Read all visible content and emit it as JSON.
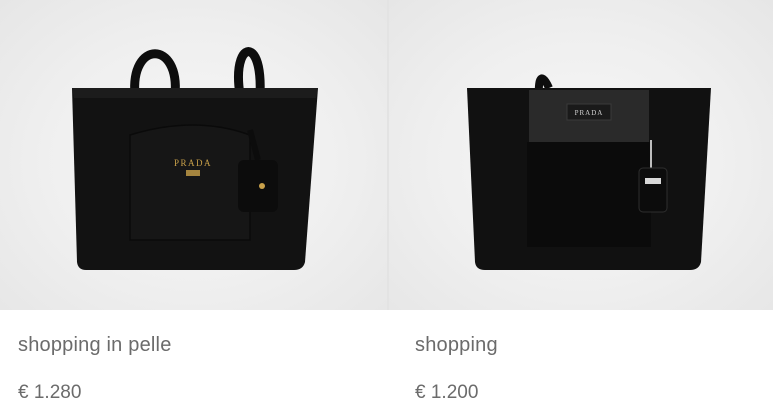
{
  "products": [
    {
      "name": "shopping in pelle",
      "price": "€ 1.280",
      "brand_mark": "PRADA"
    },
    {
      "name": "shopping",
      "price": "€ 1.200",
      "brand_mark": "PRADA"
    }
  ],
  "colors": {
    "background": "#efefef",
    "bag": "#111111",
    "text": "#6b6b6b",
    "logo_gold": "#c9a14a"
  }
}
